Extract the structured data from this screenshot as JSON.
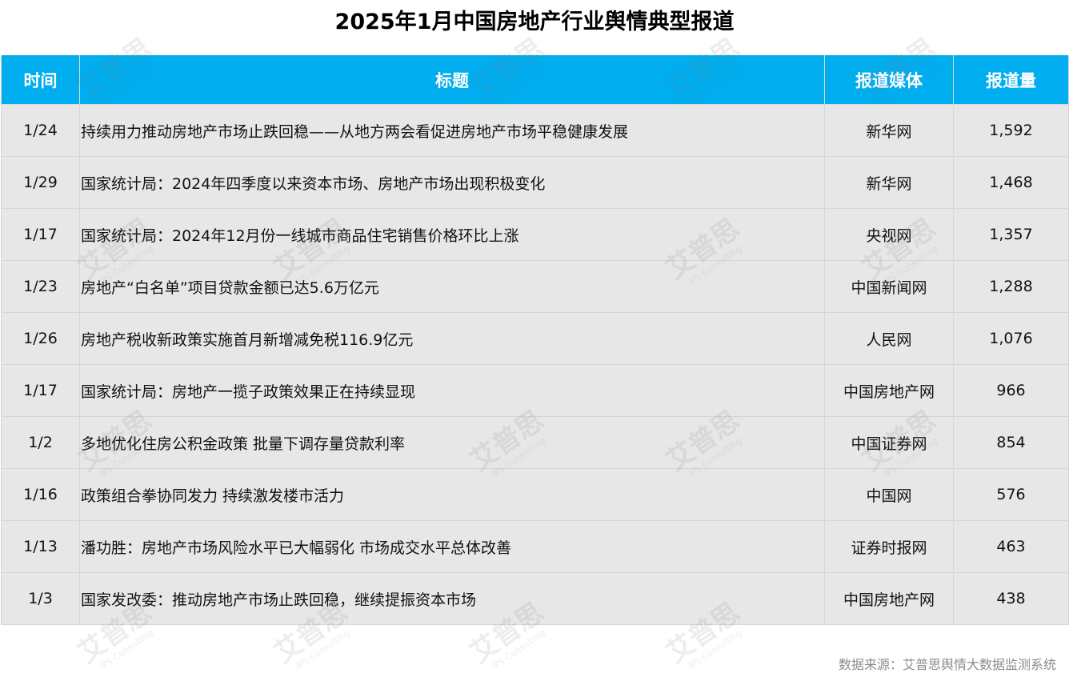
{
  "chart_data": {
    "type": "table",
    "title": "2025年1月中国房地产行业舆情典型报道",
    "columns": [
      "时间",
      "标题",
      "报道媒体",
      "报道量"
    ],
    "rows": [
      {
        "date": "1/24",
        "title": "持续用力推动房地产市场止跌回稳——从地方两会看促进房地产市场平稳健康发展",
        "media": "新华网",
        "volume": "1,592"
      },
      {
        "date": "1/29",
        "title": "国家统计局：2024年四季度以来资本市场、房地产市场出现积极变化",
        "media": "新华网",
        "volume": "1,468"
      },
      {
        "date": "1/17",
        "title": "国家统计局：2024年12月份一线城市商品住宅销售价格环比上涨",
        "media": "央视网",
        "volume": "1,357"
      },
      {
        "date": "1/23",
        "title": "房地产“白名单”项目贷款金额已达5.6万亿元",
        "media": "中国新闻网",
        "volume": "1,288"
      },
      {
        "date": "1/26",
        "title": "房地产税收新政策实施首月新增减免税116.9亿元",
        "media": "人民网",
        "volume": "1,076"
      },
      {
        "date": "1/17",
        "title": "国家统计局：房地产一揽子政策效果正在持续显现",
        "media": "中国房地产网",
        "volume": "966"
      },
      {
        "date": "1/2",
        "title": "多地优化住房公积金政策 批量下调存量贷款利率",
        "media": "中国证券网",
        "volume": "854"
      },
      {
        "date": "1/16",
        "title": "政策组合拳协同发力 持续激发楼市活力",
        "media": "中国网",
        "volume": "576"
      },
      {
        "date": "1/13",
        "title": "潘功胜：房地产市场风险水平已大幅弱化 市场成交水平总体改善",
        "media": "证券时报网",
        "volume": "463"
      },
      {
        "date": "1/3",
        "title": "国家发改委：推动房地产市场止跌回稳，继续提振资本市场",
        "media": "中国房地产网",
        "volume": "438"
      }
    ],
    "source": "数据来源：艾普思舆情大数据监测系统",
    "watermark": "艾普思",
    "watermark_sub": "iPS Consulting"
  },
  "colors": {
    "header_bg": "#00adef",
    "header_text": "#ffffff",
    "row_bg": "#e7e7e7",
    "source_text": "#8c8c8c"
  }
}
